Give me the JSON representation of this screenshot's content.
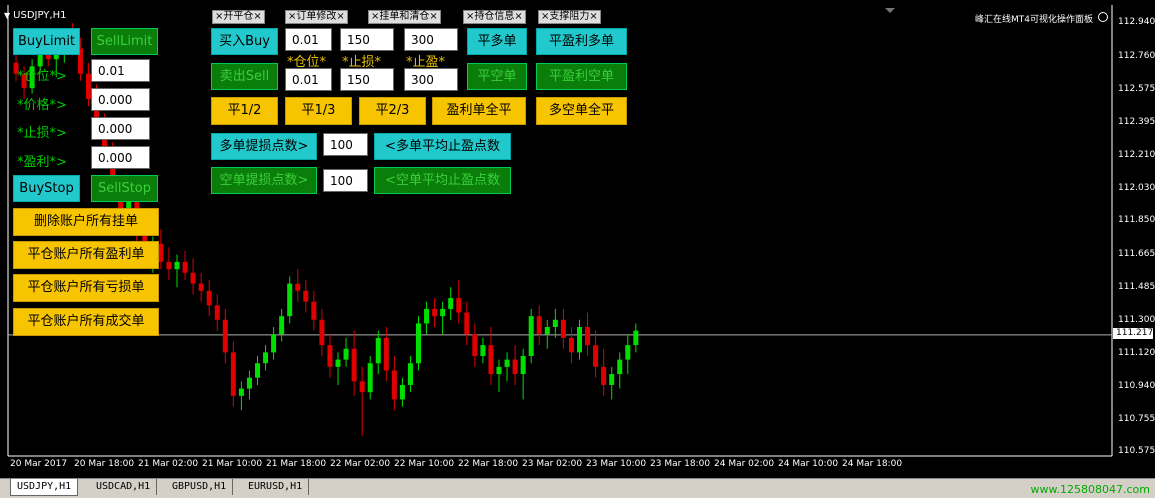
{
  "window": {
    "title": "USDJPY,H1",
    "brand": "峰汇在线MT4可视化操作面板"
  },
  "panel_tabs": [
    "×开平仓×",
    "×订单修改×",
    "×挂单和清仓×",
    "×持仓信息×",
    "×支撑阻力×"
  ],
  "left_panel": {
    "buylimit": "BuyLimit",
    "selllimit": "SellLimit",
    "lot_label": "*仓位*>",
    "lot_value": "0.01",
    "price_label": "*价格*>",
    "price_value": "0.000",
    "sl_label": "*止损*>",
    "sl_value": "0.000",
    "tp_label": "*盈利*>",
    "tp_value": "0.000",
    "buystop": "BuyStop",
    "sellstop": "SellStop",
    "delete_pending": "删除账户所有挂单",
    "close_profit": "平仓账户所有盈利单",
    "close_loss": "平仓账户所有亏损单",
    "close_all": "平仓账户所有成交单"
  },
  "trade_panel": {
    "buy": "买入Buy",
    "sell": "卖出Sell",
    "buy_lot": "0.01",
    "buy_sl": "150",
    "buy_tp": "300",
    "sell_lot": "0.01",
    "sell_sl": "150",
    "sell_tp": "300",
    "lot_caption": "*仓位*",
    "sl_caption": "*止损*",
    "tp_caption": "*止盈*",
    "close_buy": "平多单",
    "close_profit_buy": "平盈利多单",
    "close_sell": "平空单",
    "close_profit_sell": "平盈利空单",
    "half": "平1/2",
    "third": "平1/3",
    "two_third": "平2/3",
    "close_profit_all": "盈利单全平",
    "close_all": "多空单全平",
    "buy_pts_label": "多单提损点数>",
    "buy_pts": "100",
    "buy_avg_tp": "<多单平均止盈点数",
    "sell_pts_label": "空单提损点数>",
    "sell_pts": "100",
    "sell_avg_tp": "<空单平均止盈点数"
  },
  "price_axis": [
    "112.940",
    "112.760",
    "112.575",
    "112.395",
    "112.210",
    "112.030",
    "111.850",
    "111.665",
    "111.485",
    "111.300",
    "111.120",
    "110.940",
    "110.755",
    "110.575"
  ],
  "current_price": "111.217",
  "time_axis": [
    "20 Mar 2017",
    "20 Mar 18:00",
    "21 Mar 02:00",
    "21 Mar 10:00",
    "21 Mar 18:00",
    "22 Mar 02:00",
    "22 Mar 10:00",
    "22 Mar 18:00",
    "23 Mar 02:00",
    "23 Mar 10:00",
    "23 Mar 18:00",
    "24 Mar 02:00",
    "24 Mar 10:00",
    "24 Mar 18:00"
  ],
  "symbol_tabs": [
    "USDJPY,H1",
    "USDCAD,H1",
    "GBPUSD,H1",
    "EURUSD,H1"
  ],
  "website": "www.125808047.com",
  "colors": {
    "up": "#00e000",
    "down": "#e00000",
    "cyan": "#22c9cc",
    "green": "#0a7d0a",
    "yellow": "#f7c400"
  },
  "chart_data": {
    "type": "candlestick",
    "symbol": "USDJPY",
    "timeframe": "H1",
    "ylim": [
      110.575,
      112.94
    ],
    "candles": [
      [
        112.72,
        112.78,
        112.62,
        112.66
      ],
      [
        112.66,
        112.7,
        112.52,
        112.58
      ],
      [
        112.58,
        112.74,
        112.55,
        112.7
      ],
      [
        112.7,
        112.84,
        112.66,
        112.8
      ],
      [
        112.8,
        112.88,
        112.7,
        112.74
      ],
      [
        112.74,
        112.82,
        112.64,
        112.78
      ],
      [
        112.78,
        112.9,
        112.72,
        112.86
      ],
      [
        112.86,
        112.94,
        112.76,
        112.8
      ],
      [
        112.8,
        112.86,
        112.62,
        112.66
      ],
      [
        112.66,
        112.72,
        112.48,
        112.52
      ],
      [
        112.52,
        112.6,
        112.3,
        112.36
      ],
      [
        112.36,
        112.44,
        112.14,
        112.2
      ],
      [
        112.2,
        112.28,
        111.98,
        112.04
      ],
      [
        112.04,
        112.1,
        111.84,
        111.9
      ],
      [
        111.9,
        112.0,
        111.8,
        111.96
      ],
      [
        111.96,
        112.02,
        111.72,
        111.78
      ],
      [
        111.78,
        111.84,
        111.62,
        111.68
      ],
      [
        111.68,
        111.76,
        111.56,
        111.72
      ],
      [
        111.72,
        111.8,
        111.58,
        111.62
      ],
      [
        111.62,
        111.7,
        111.52,
        111.58
      ],
      [
        111.58,
        111.66,
        111.48,
        111.62
      ],
      [
        111.62,
        111.68,
        111.52,
        111.56
      ],
      [
        111.56,
        111.64,
        111.44,
        111.5
      ],
      [
        111.5,
        111.56,
        111.4,
        111.46
      ],
      [
        111.46,
        111.52,
        111.32,
        111.38
      ],
      [
        111.38,
        111.44,
        111.24,
        111.3
      ],
      [
        111.3,
        111.36,
        111.06,
        111.12
      ],
      [
        111.12,
        111.18,
        110.82,
        110.88
      ],
      [
        110.88,
        110.96,
        110.8,
        110.92
      ],
      [
        110.92,
        111.02,
        110.86,
        110.98
      ],
      [
        110.98,
        111.1,
        110.94,
        111.06
      ],
      [
        111.06,
        111.16,
        111.02,
        111.12
      ],
      [
        111.12,
        111.26,
        111.08,
        111.22
      ],
      [
        111.22,
        111.36,
        111.18,
        111.32
      ],
      [
        111.32,
        111.54,
        111.28,
        111.5
      ],
      [
        111.5,
        111.58,
        111.4,
        111.46
      ],
      [
        111.46,
        111.52,
        111.34,
        111.4
      ],
      [
        111.4,
        111.46,
        111.24,
        111.3
      ],
      [
        111.3,
        111.36,
        111.1,
        111.16
      ],
      [
        111.16,
        111.22,
        110.98,
        111.04
      ],
      [
        111.04,
        111.12,
        110.94,
        111.08
      ],
      [
        111.08,
        111.2,
        111.04,
        111.14
      ],
      [
        111.14,
        111.24,
        110.88,
        110.96
      ],
      [
        110.96,
        111.04,
        110.66,
        110.9
      ],
      [
        110.9,
        111.1,
        110.86,
        111.06
      ],
      [
        111.06,
        111.24,
        111.0,
        111.2
      ],
      [
        111.2,
        111.26,
        110.96,
        111.02
      ],
      [
        111.02,
        111.1,
        110.8,
        110.86
      ],
      [
        110.86,
        110.98,
        110.82,
        110.94
      ],
      [
        110.94,
        111.1,
        110.9,
        111.06
      ],
      [
        111.06,
        111.32,
        111.02,
        111.28
      ],
      [
        111.28,
        111.4,
        111.22,
        111.36
      ],
      [
        111.36,
        111.42,
        111.26,
        111.32
      ],
      [
        111.32,
        111.4,
        111.22,
        111.36
      ],
      [
        111.36,
        111.48,
        111.3,
        111.42
      ],
      [
        111.42,
        111.52,
        111.28,
        111.34
      ],
      [
        111.34,
        111.4,
        111.16,
        111.22
      ],
      [
        111.22,
        111.28,
        111.04,
        111.1
      ],
      [
        111.1,
        111.2,
        111.06,
        111.16
      ],
      [
        111.16,
        111.26,
        110.94,
        111.0
      ],
      [
        111.0,
        111.08,
        110.9,
        111.04
      ],
      [
        111.04,
        111.12,
        110.96,
        111.08
      ],
      [
        111.08,
        111.16,
        110.94,
        111.0
      ],
      [
        111.0,
        111.14,
        110.86,
        111.1
      ],
      [
        111.1,
        111.36,
        111.06,
        111.32
      ],
      [
        111.32,
        111.38,
        111.16,
        111.22
      ],
      [
        111.22,
        111.3,
        111.14,
        111.26
      ],
      [
        111.26,
        111.36,
        111.2,
        111.3
      ],
      [
        111.3,
        111.36,
        111.14,
        111.2
      ],
      [
        111.2,
        111.26,
        111.06,
        111.12
      ],
      [
        111.12,
        111.3,
        111.08,
        111.26
      ],
      [
        111.26,
        111.34,
        111.1,
        111.16
      ],
      [
        111.16,
        111.24,
        110.98,
        111.04
      ],
      [
        111.04,
        111.14,
        110.88,
        110.94
      ],
      [
        110.94,
        111.04,
        110.86,
        111.0
      ],
      [
        111.0,
        111.12,
        110.92,
        111.08
      ],
      [
        111.08,
        111.22,
        111.0,
        111.16
      ],
      [
        111.16,
        111.28,
        111.12,
        111.24
      ]
    ]
  }
}
